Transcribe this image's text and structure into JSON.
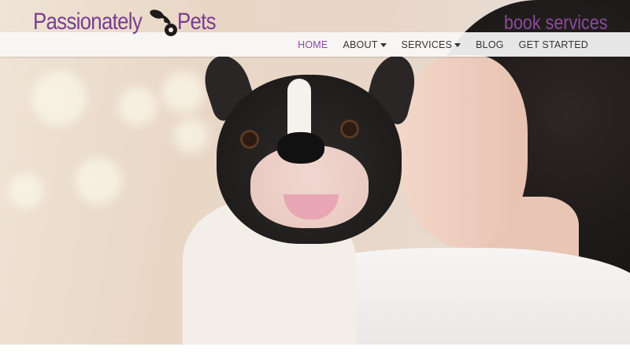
{
  "brand": {
    "name_part1": "Passionately",
    "name_part2": "Pets",
    "logo_icon": "pet-tag-icon",
    "color": "#7a3c8f"
  },
  "header": {
    "book_services": "book services"
  },
  "nav": {
    "items": [
      {
        "label": "HOME",
        "active": true
      },
      {
        "label": "ABOUT",
        "dropdown": true
      },
      {
        "label": "SERVICES",
        "dropdown": true
      },
      {
        "label": "BLOG"
      },
      {
        "label": "GET STARTED"
      }
    ],
    "active_color": "#8a4b9e"
  },
  "hero": {
    "image": "woman-kissing-french-bulldog-photo"
  }
}
